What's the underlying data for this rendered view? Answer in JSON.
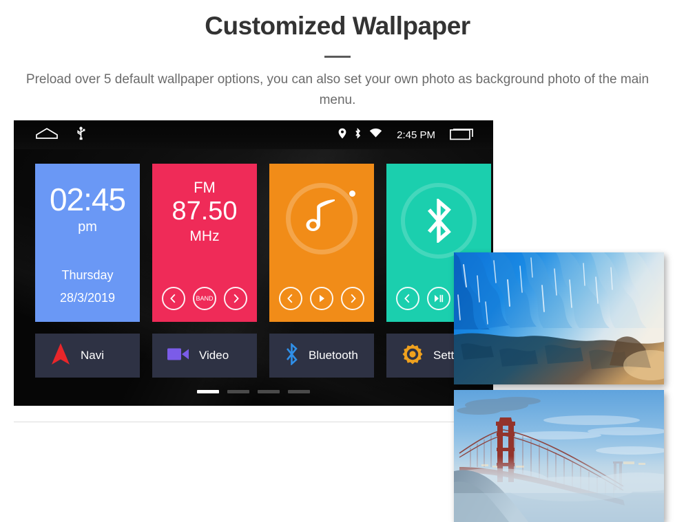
{
  "header": {
    "title": "Customized Wallpaper",
    "subtitle": "Preload over 5 default wallpaper options, you can also set your own photo as background photo of the main menu."
  },
  "device": {
    "status_bar": {
      "home_icon": "home-icon",
      "usb_icon": "usb-icon",
      "location_icon": "location-pin-icon",
      "bluetooth_icon": "bluetooth-icon",
      "wifi_icon": "wifi-icon",
      "time": "2:45 PM",
      "recents_icon": "recent-apps-icon"
    },
    "widgets": {
      "clock": {
        "name": "clock-widget",
        "time": "02:45",
        "ampm": "pm",
        "weekday": "Thursday",
        "date": "28/3/2019",
        "color": "#6a98f5"
      },
      "radio": {
        "name": "fm-radio-widget",
        "band": "FM",
        "frequency": "87.50",
        "unit": "MHz",
        "color": "#ef2b58",
        "controls": {
          "prev": "prev-station-button",
          "band": "BAND",
          "next": "next-station-button"
        }
      },
      "music": {
        "name": "music-widget",
        "icon": "music-note-icon",
        "color": "#f18c18",
        "controls": {
          "prev": "previous-track-button",
          "play": "play-button",
          "next": "next-track-button"
        }
      },
      "bluetooth": {
        "name": "bluetooth-widget",
        "icon": "bluetooth-icon",
        "color": "#1bcfae",
        "controls": {
          "prev": "previous-button",
          "playpause": "play-pause-button"
        }
      }
    },
    "shortcuts": [
      {
        "label": "Navi",
        "icon": "navigation-arrow-icon",
        "color": "#e8262a"
      },
      {
        "label": "Video",
        "icon": "video-camera-icon",
        "color": "#7b5ce8"
      },
      {
        "label": "Bluetooth",
        "icon": "bluetooth-icon",
        "color": "#2f8fe8"
      },
      {
        "label": "Settings",
        "icon": "gear-icon",
        "color": "#efa11e"
      }
    ],
    "page_indicator": {
      "total": 4,
      "active": 1
    }
  },
  "wallpapers": [
    {
      "name": "wallpaper-ice-cave",
      "description": "Blue ice cave"
    },
    {
      "name": "wallpaper-golden-gate-fog",
      "description": "Golden Gate Bridge in fog"
    }
  ]
}
